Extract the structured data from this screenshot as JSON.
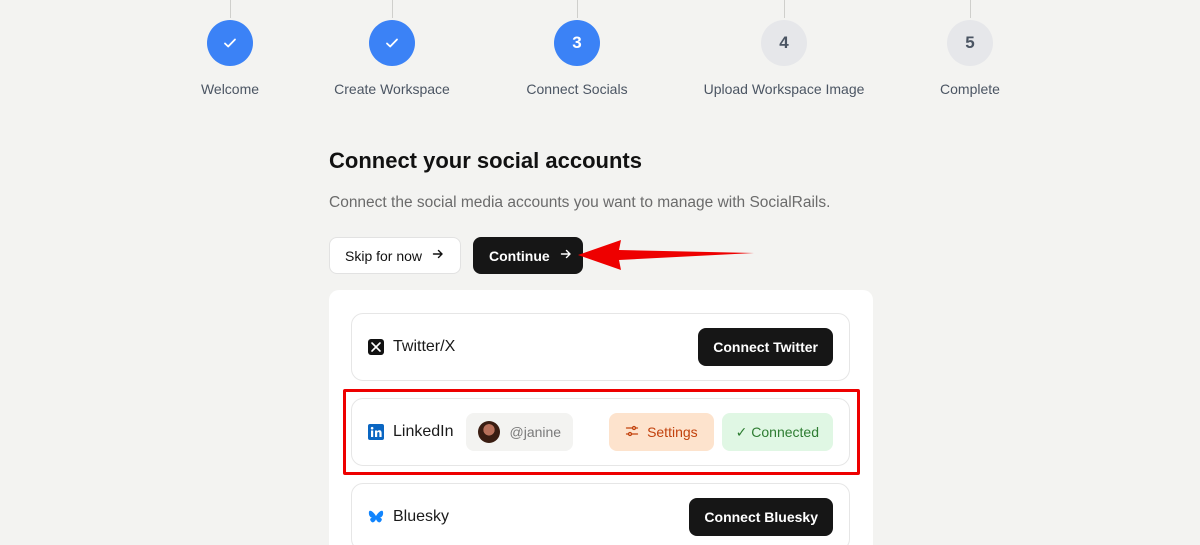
{
  "stepper": {
    "steps": [
      {
        "number": "",
        "label": "Welcome",
        "state": "done"
      },
      {
        "number": "",
        "label": "Create Workspace",
        "state": "done"
      },
      {
        "number": "3",
        "label": "Connect Socials",
        "state": "active"
      },
      {
        "number": "4",
        "label": "Upload Workspace Image",
        "state": "todo"
      },
      {
        "number": "5",
        "label": "Complete",
        "state": "todo"
      }
    ]
  },
  "page": {
    "title": "Connect your social accounts",
    "subtitle": "Connect the social media accounts you want to manage with SocialRails."
  },
  "actions": {
    "skip_label": "Skip for now",
    "continue_label": "Continue"
  },
  "accounts": [
    {
      "name": "Twitter/X",
      "icon": "x-logo-icon",
      "status": "disconnected",
      "button_label": "Connect Twitter"
    },
    {
      "name": "LinkedIn",
      "icon": "linkedin-logo-icon",
      "status": "connected",
      "handle": "@janine",
      "settings_label": "Settings",
      "connected_label": "✓ Connected"
    },
    {
      "name": "Bluesky",
      "icon": "bluesky-logo-icon",
      "status": "disconnected",
      "button_label": "Connect Bluesky"
    }
  ],
  "colors": {
    "accent": "#3b82f6",
    "primary_button": "#161616",
    "settings_bg": "#fde3cd",
    "settings_text": "#c2410c",
    "connected_bg": "#e0f7e4",
    "connected_text": "#2e7d32",
    "annotation": "#ee0000"
  }
}
